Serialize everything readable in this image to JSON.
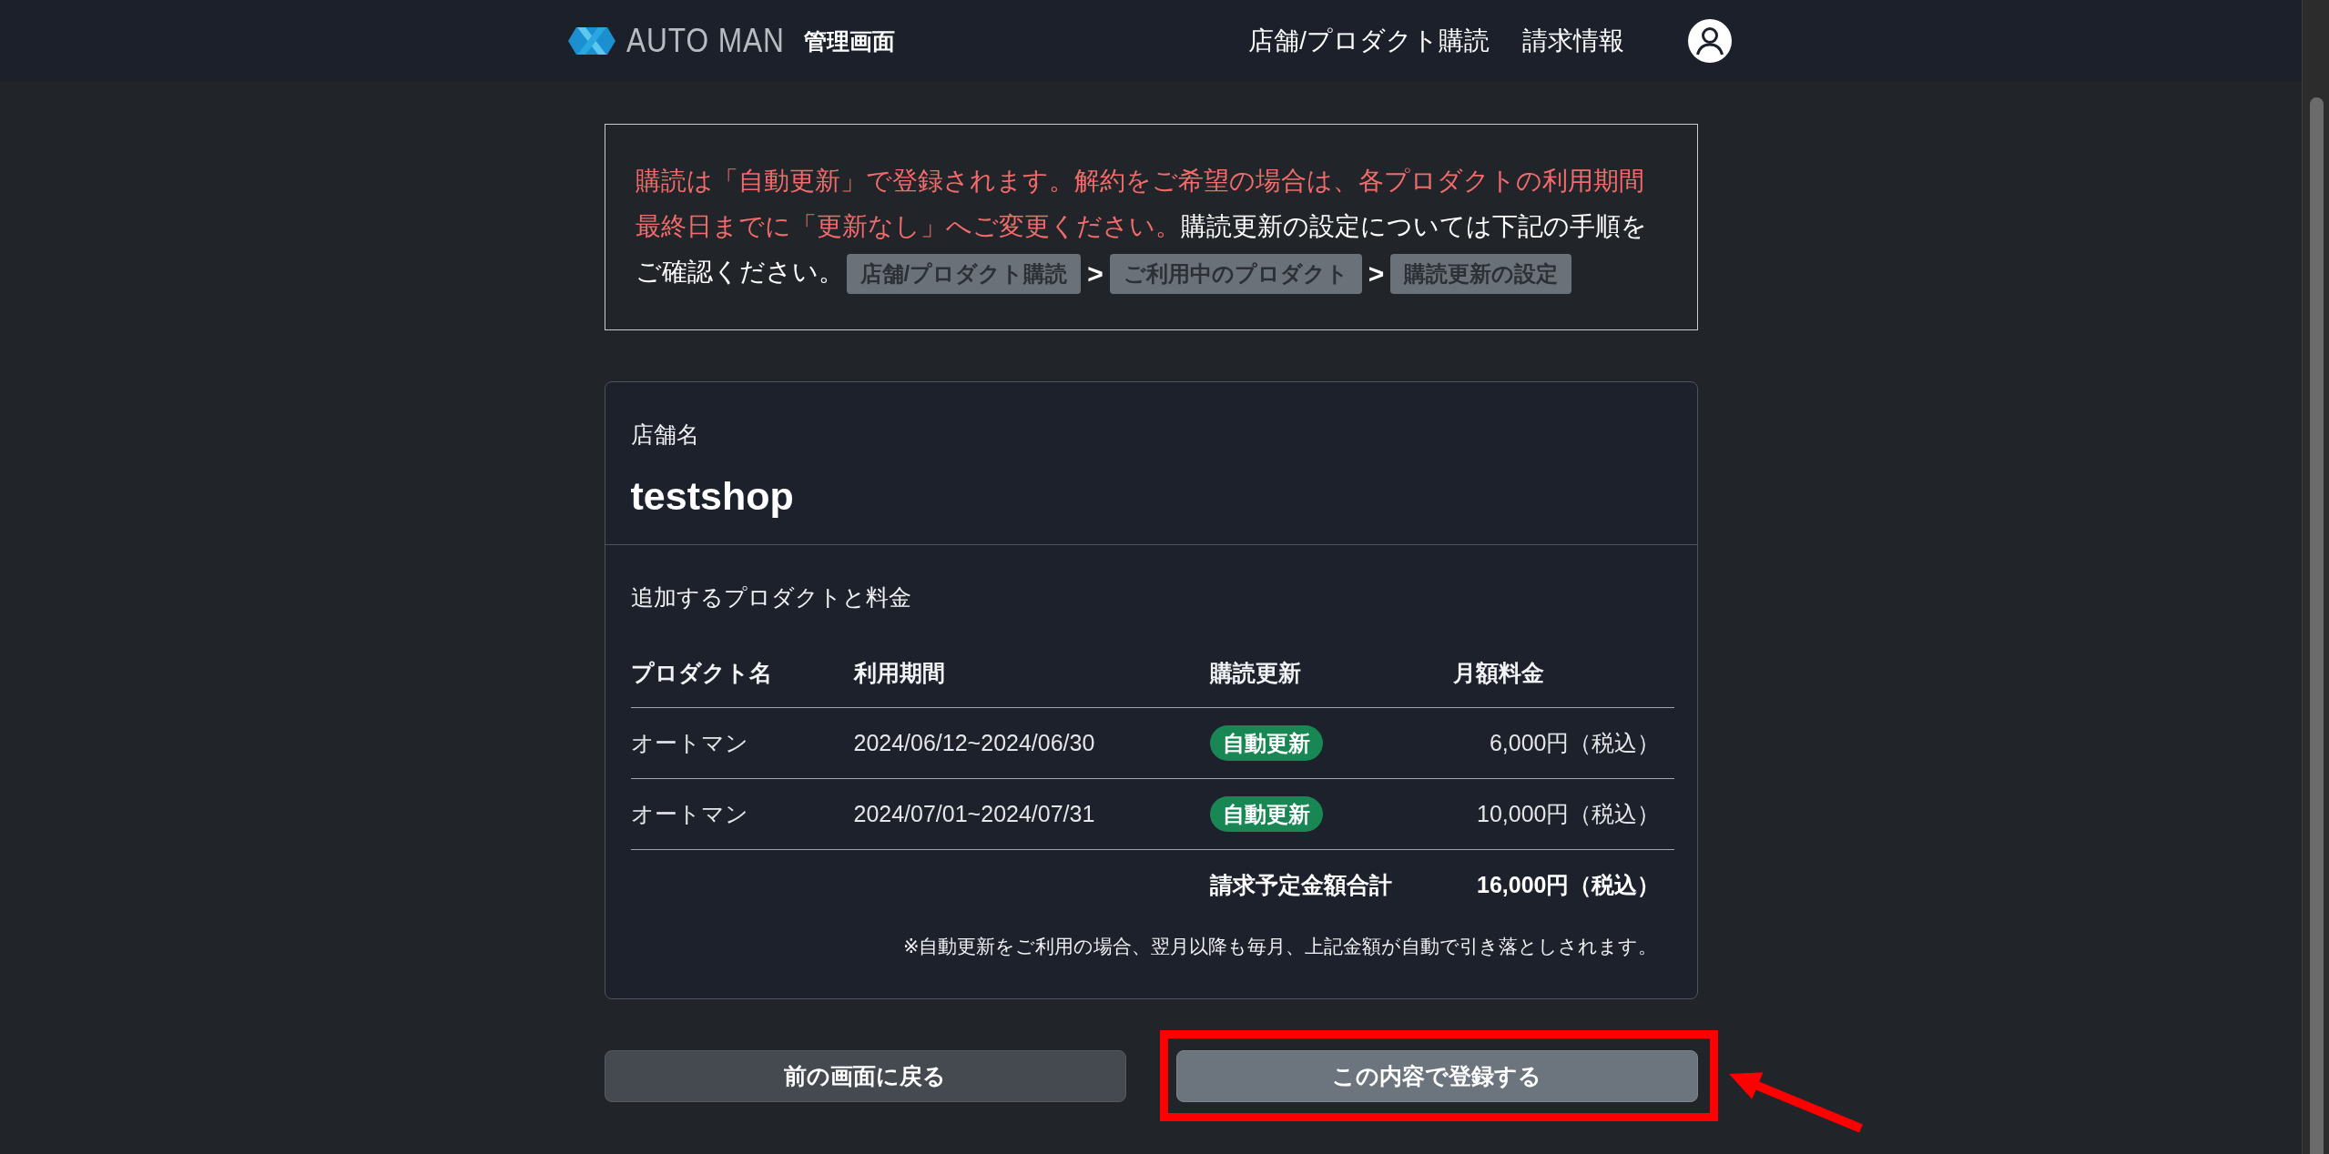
{
  "header": {
    "logo_text": "AUTO MAN",
    "subtitle": "管理画面",
    "nav": [
      {
        "label": "店舗/プロダクト購読"
      },
      {
        "label": "請求情報"
      }
    ]
  },
  "notice": {
    "warning": "購読は「自動更新」で登録されます。解約をご希望の場合は、各プロダクトの利用期間最終日までに「更新なし」へご変更ください。",
    "text": "購読更新の設定については下記の手順をご確認ください。",
    "path": [
      {
        "label": "店舗/プロダクト購読",
        "separator": ">"
      },
      {
        "label": "ご利用中のプロダクト",
        "separator": ">"
      },
      {
        "label": "購読更新の設定"
      }
    ]
  },
  "shop": {
    "label": "店舗名",
    "name": "testshop"
  },
  "products": {
    "title": "追加するプロダクトと料金",
    "columns": [
      "プロダクト名",
      "利用期間",
      "購読更新",
      "月額料金"
    ],
    "rows": [
      {
        "product": "オートマン",
        "period": "2024/06/12~2024/06/30",
        "renewal": "自動更新",
        "auto_renew": true,
        "price": "6,000円（税込）"
      },
      {
        "product": "オートマン",
        "period": "2024/07/01~2024/07/31",
        "renewal": "自動更新",
        "auto_renew": true,
        "price": "10,000円（税込）"
      }
    ],
    "total": {
      "label": "請求予定金額合計",
      "amount": "16,000円（税込）"
    },
    "note": "※自動更新をご利用の場合、翌月以降も毎月、上記金額が自動で引き落としされます。"
  },
  "buttons": [
    {
      "label": "前の画面に戻る",
      "kind": "secondary",
      "highlighted": false
    },
    {
      "label": "この内容で登録する",
      "kind": "primary",
      "highlighted": true
    }
  ]
}
